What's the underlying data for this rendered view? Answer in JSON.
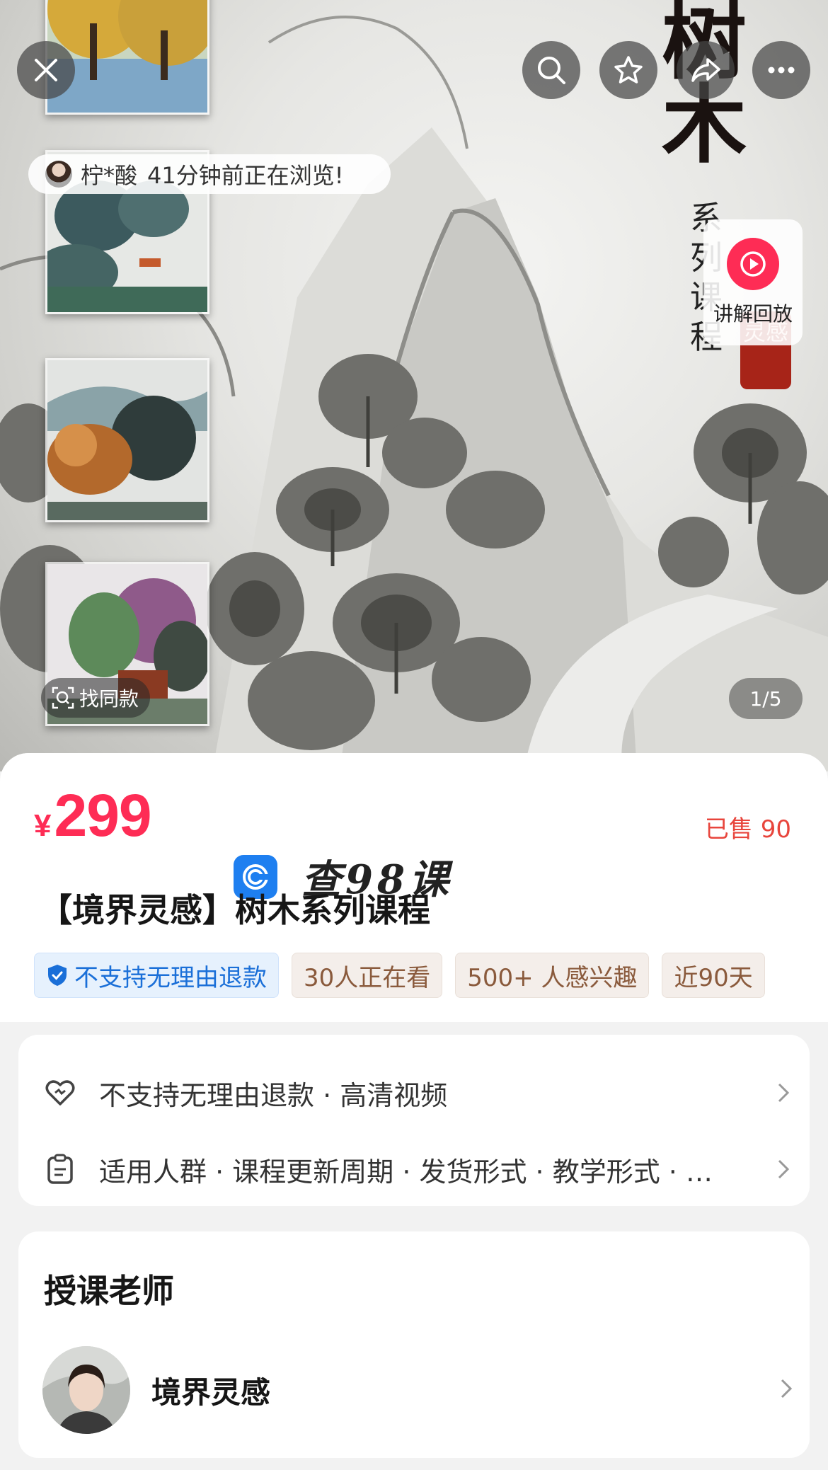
{
  "hero": {
    "title_chars": "树木",
    "subtitle_chars": "系列课程",
    "seal_text": "灵感",
    "browse_notice": {
      "user": "柠*酸",
      "message": "41分钟前正在浏览!"
    },
    "replay_label": "讲解回放",
    "find_same_label": "找同款",
    "pager": "1/5"
  },
  "top_bar": {
    "close_icon": "close-icon",
    "search_icon": "search-icon",
    "favorite_icon": "star-icon",
    "share_icon": "share-icon",
    "more_icon": "more-icon"
  },
  "product": {
    "currency": "¥",
    "price": "299",
    "sold": "已售 90",
    "title": "【境界灵感】树木系列课程",
    "watermark": "查98课",
    "tags": [
      {
        "label": "不支持无理由退款",
        "style": "blue"
      },
      {
        "label": "30人正在看",
        "style": "tan"
      },
      {
        "label": "500+ 人感兴趣",
        "style": "tan"
      },
      {
        "label": "近90天",
        "style": "tan"
      }
    ]
  },
  "info": {
    "row1": "不支持无理由退款 · 高清视频",
    "row2": "适用人群 · 课程更新周期 · 发货形式 · 教学形式 · …"
  },
  "teacher": {
    "heading": "授课老师",
    "name": "境界灵感"
  },
  "colors": {
    "price_red": "#fe2c55",
    "sold_red": "#e8453c",
    "tag_blue": "#1a6fd8",
    "tag_tan": "#8a5a3c"
  }
}
